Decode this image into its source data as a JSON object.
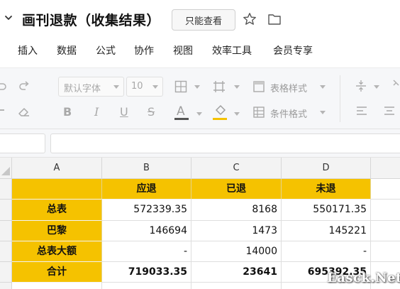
{
  "titlebar": {
    "title": "画刊退款（收集结果）",
    "readonly_label": "只能查看"
  },
  "menu": {
    "items": [
      "插入",
      "数据",
      "公式",
      "协作",
      "视图",
      "效率工具",
      "会员专享"
    ]
  },
  "toolbar": {
    "font_name": "默认字体",
    "font_size": "10",
    "table_style_label": "表格样式",
    "conditional_format_label": "条件格式",
    "icons": [
      "undo-icon",
      "redo-icon",
      "eraser-icon",
      "bold-icon",
      "italic-icon",
      "underline-icon",
      "strikethrough-icon",
      "font-color-icon",
      "fill-color-icon",
      "border-icon",
      "merge-icon",
      "table-style-icon",
      "conditional-format-icon",
      "align-vertical-icon",
      "align-left-icon",
      "align-center-icon",
      "wrap-icon"
    ],
    "font_color_bar": "#555555",
    "fill_color_bar": "#f5c200"
  },
  "sheet": {
    "columns": [
      "A",
      "B",
      "C",
      "D"
    ],
    "header_row": [
      "",
      "应退",
      "已退",
      "未退"
    ],
    "rows": [
      {
        "label": "总表",
        "b": "572339.35",
        "c": "8168",
        "d": "550171.35"
      },
      {
        "label": "巴黎",
        "b": "146694",
        "c": "1473",
        "d": "145221"
      },
      {
        "label": "总表大额",
        "b": "-",
        "c": "14000",
        "d": "-"
      },
      {
        "label": "合计",
        "b": "719033.35",
        "c": "23641",
        "d": "695392.35"
      }
    ],
    "highlight_color": "#f5c200"
  },
  "watermark": "Easck.Net"
}
